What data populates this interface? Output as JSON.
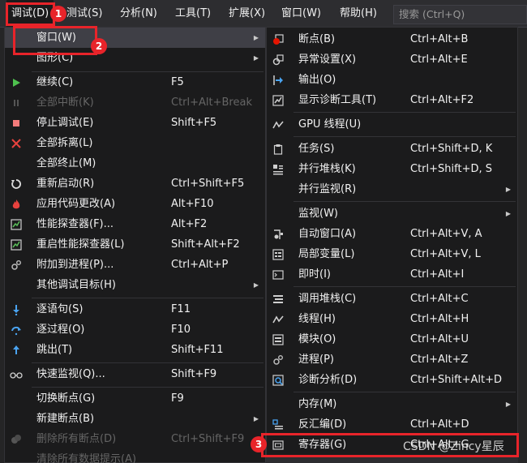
{
  "menubar": {
    "items": [
      "调试(D)",
      "测试(S)",
      "分析(N)",
      "工具(T)",
      "扩展(X)",
      "窗口(W)",
      "帮助(H)"
    ],
    "search_placeholder": "搜索 (Ctrl+Q)"
  },
  "debug_menu": {
    "items": [
      {
        "label": "窗口(W)",
        "shortcut": ""
      },
      {
        "label": "图形(C)",
        "shortcut": ""
      },
      {
        "label": "继续(C)",
        "shortcut": "F5"
      },
      {
        "label": "全部中断(K)",
        "shortcut": "Ctrl+Alt+Break"
      },
      {
        "label": "停止调试(E)",
        "shortcut": "Shift+F5"
      },
      {
        "label": "全部拆离(L)",
        "shortcut": ""
      },
      {
        "label": "全部终止(M)",
        "shortcut": ""
      },
      {
        "label": "重新启动(R)",
        "shortcut": "Ctrl+Shift+F5"
      },
      {
        "label": "应用代码更改(A)",
        "shortcut": "Alt+F10"
      },
      {
        "label": "性能探查器(F)...",
        "shortcut": "Alt+F2"
      },
      {
        "label": "重启性能探查器(L)",
        "shortcut": "Shift+Alt+F2"
      },
      {
        "label": "附加到进程(P)...",
        "shortcut": "Ctrl+Alt+P"
      },
      {
        "label": "其他调试目标(H)",
        "shortcut": ""
      },
      {
        "label": "逐语句(S)",
        "shortcut": "F11"
      },
      {
        "label": "逐过程(O)",
        "shortcut": "F10"
      },
      {
        "label": "跳出(T)",
        "shortcut": "Shift+F11"
      },
      {
        "label": "快速监视(Q)...",
        "shortcut": "Shift+F9"
      },
      {
        "label": "切换断点(G)",
        "shortcut": "F9"
      },
      {
        "label": "新建断点(B)",
        "shortcut": ""
      },
      {
        "label": "删除所有断点(D)",
        "shortcut": "Ctrl+Shift+F9"
      },
      {
        "label": "清除所有数据提示(A)",
        "shortcut": ""
      }
    ]
  },
  "window_submenu": {
    "items": [
      {
        "label": "断点(B)",
        "shortcut": "Ctrl+Alt+B"
      },
      {
        "label": "异常设置(X)",
        "shortcut": "Ctrl+Alt+E"
      },
      {
        "label": "输出(O)",
        "shortcut": ""
      },
      {
        "label": "显示诊断工具(T)",
        "shortcut": "Ctrl+Alt+F2"
      },
      {
        "label": "GPU 线程(U)",
        "shortcut": ""
      },
      {
        "label": "任务(S)",
        "shortcut": "Ctrl+Shift+D, K"
      },
      {
        "label": "并行堆栈(K)",
        "shortcut": "Ctrl+Shift+D, S"
      },
      {
        "label": "并行监视(R)",
        "shortcut": ""
      },
      {
        "label": "监视(W)",
        "shortcut": ""
      },
      {
        "label": "自动窗口(A)",
        "shortcut": "Ctrl+Alt+V, A"
      },
      {
        "label": "局部变量(L)",
        "shortcut": "Ctrl+Alt+V, L"
      },
      {
        "label": "即时(I)",
        "shortcut": "Ctrl+Alt+I"
      },
      {
        "label": "调用堆栈(C)",
        "shortcut": "Ctrl+Alt+C"
      },
      {
        "label": "线程(H)",
        "shortcut": "Ctrl+Alt+H"
      },
      {
        "label": "模块(O)",
        "shortcut": "Ctrl+Alt+U"
      },
      {
        "label": "进程(P)",
        "shortcut": "Ctrl+Alt+Z"
      },
      {
        "label": "诊断分析(D)",
        "shortcut": "Ctrl+Shift+Alt+D"
      },
      {
        "label": "内存(M)",
        "shortcut": ""
      },
      {
        "label": "反汇编(D)",
        "shortcut": "Ctrl+Alt+D"
      },
      {
        "label": "寄存器(G)",
        "shortcut": "Ctrl+Alt+G"
      }
    ]
  },
  "annotations": {
    "badge1": "1",
    "badge2": "2",
    "badge3": "3"
  },
  "watermark": "CSDN @Zincy星辰",
  "colors": {
    "menu_bg": "#1b1b1c",
    "highlight": "#3f3f46",
    "annotation": "#e8242a",
    "disabled": "#656565"
  }
}
